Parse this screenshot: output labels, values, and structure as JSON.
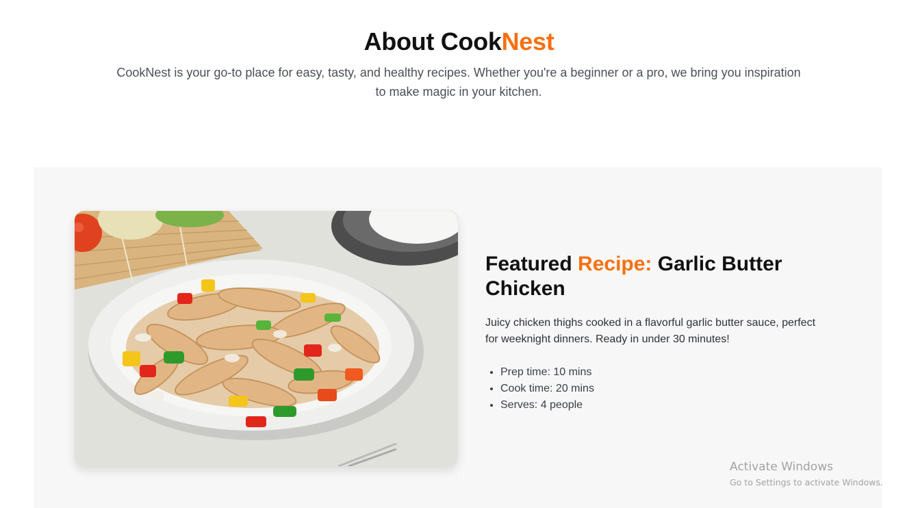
{
  "about": {
    "title_prefix": "About Cook",
    "title_accent": "Nest",
    "description": "CookNest is your go-to place for easy, tasty, and healthy recipes. Whether you're a beginner or a pro, we bring you inspiration to make magic in your kitchen."
  },
  "featured": {
    "title_part1": "Featured ",
    "title_accent": "Recipe:",
    "title_part2": " Garlic Butter Chicken",
    "description": "Juicy chicken thighs cooked in a flavorful garlic butter sauce, perfect for weeknight dinners. Ready in under 30 minutes!",
    "facts": [
      "Prep time: 10 mins",
      "Cook time: 20 mins",
      "Serves: 4 people"
    ]
  },
  "watermark": {
    "title": "Activate Windows",
    "subtitle": "Go to Settings to activate Windows."
  },
  "colors": {
    "accent": "#f7700f",
    "heading": "#111111",
    "body_text": "#4a4f57",
    "section_bg": "#f7f7f7"
  }
}
